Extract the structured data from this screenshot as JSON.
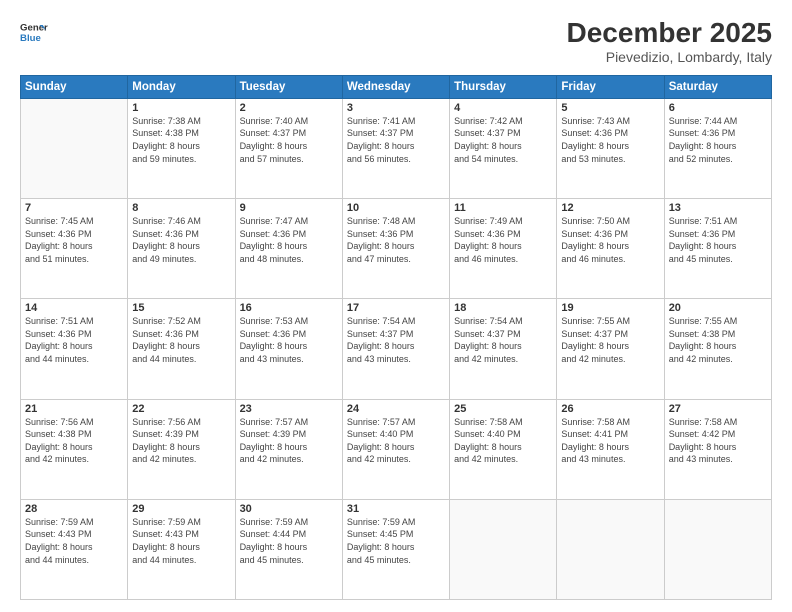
{
  "logo": {
    "line1": "General",
    "line2": "Blue"
  },
  "title": "December 2025",
  "subtitle": "Pievedizio, Lombardy, Italy",
  "weekdays": [
    "Sunday",
    "Monday",
    "Tuesday",
    "Wednesday",
    "Thursday",
    "Friday",
    "Saturday"
  ],
  "weeks": [
    [
      {
        "day": "",
        "info": ""
      },
      {
        "day": "1",
        "info": "Sunrise: 7:38 AM\nSunset: 4:38 PM\nDaylight: 8 hours\nand 59 minutes."
      },
      {
        "day": "2",
        "info": "Sunrise: 7:40 AM\nSunset: 4:37 PM\nDaylight: 8 hours\nand 57 minutes."
      },
      {
        "day": "3",
        "info": "Sunrise: 7:41 AM\nSunset: 4:37 PM\nDaylight: 8 hours\nand 56 minutes."
      },
      {
        "day": "4",
        "info": "Sunrise: 7:42 AM\nSunset: 4:37 PM\nDaylight: 8 hours\nand 54 minutes."
      },
      {
        "day": "5",
        "info": "Sunrise: 7:43 AM\nSunset: 4:36 PM\nDaylight: 8 hours\nand 53 minutes."
      },
      {
        "day": "6",
        "info": "Sunrise: 7:44 AM\nSunset: 4:36 PM\nDaylight: 8 hours\nand 52 minutes."
      }
    ],
    [
      {
        "day": "7",
        "info": "Sunrise: 7:45 AM\nSunset: 4:36 PM\nDaylight: 8 hours\nand 51 minutes."
      },
      {
        "day": "8",
        "info": "Sunrise: 7:46 AM\nSunset: 4:36 PM\nDaylight: 8 hours\nand 49 minutes."
      },
      {
        "day": "9",
        "info": "Sunrise: 7:47 AM\nSunset: 4:36 PM\nDaylight: 8 hours\nand 48 minutes."
      },
      {
        "day": "10",
        "info": "Sunrise: 7:48 AM\nSunset: 4:36 PM\nDaylight: 8 hours\nand 47 minutes."
      },
      {
        "day": "11",
        "info": "Sunrise: 7:49 AM\nSunset: 4:36 PM\nDaylight: 8 hours\nand 46 minutes."
      },
      {
        "day": "12",
        "info": "Sunrise: 7:50 AM\nSunset: 4:36 PM\nDaylight: 8 hours\nand 46 minutes."
      },
      {
        "day": "13",
        "info": "Sunrise: 7:51 AM\nSunset: 4:36 PM\nDaylight: 8 hours\nand 45 minutes."
      }
    ],
    [
      {
        "day": "14",
        "info": "Sunrise: 7:51 AM\nSunset: 4:36 PM\nDaylight: 8 hours\nand 44 minutes."
      },
      {
        "day": "15",
        "info": "Sunrise: 7:52 AM\nSunset: 4:36 PM\nDaylight: 8 hours\nand 44 minutes."
      },
      {
        "day": "16",
        "info": "Sunrise: 7:53 AM\nSunset: 4:36 PM\nDaylight: 8 hours\nand 43 minutes."
      },
      {
        "day": "17",
        "info": "Sunrise: 7:54 AM\nSunset: 4:37 PM\nDaylight: 8 hours\nand 43 minutes."
      },
      {
        "day": "18",
        "info": "Sunrise: 7:54 AM\nSunset: 4:37 PM\nDaylight: 8 hours\nand 42 minutes."
      },
      {
        "day": "19",
        "info": "Sunrise: 7:55 AM\nSunset: 4:37 PM\nDaylight: 8 hours\nand 42 minutes."
      },
      {
        "day": "20",
        "info": "Sunrise: 7:55 AM\nSunset: 4:38 PM\nDaylight: 8 hours\nand 42 minutes."
      }
    ],
    [
      {
        "day": "21",
        "info": "Sunrise: 7:56 AM\nSunset: 4:38 PM\nDaylight: 8 hours\nand 42 minutes."
      },
      {
        "day": "22",
        "info": "Sunrise: 7:56 AM\nSunset: 4:39 PM\nDaylight: 8 hours\nand 42 minutes."
      },
      {
        "day": "23",
        "info": "Sunrise: 7:57 AM\nSunset: 4:39 PM\nDaylight: 8 hours\nand 42 minutes."
      },
      {
        "day": "24",
        "info": "Sunrise: 7:57 AM\nSunset: 4:40 PM\nDaylight: 8 hours\nand 42 minutes."
      },
      {
        "day": "25",
        "info": "Sunrise: 7:58 AM\nSunset: 4:40 PM\nDaylight: 8 hours\nand 42 minutes."
      },
      {
        "day": "26",
        "info": "Sunrise: 7:58 AM\nSunset: 4:41 PM\nDaylight: 8 hours\nand 43 minutes."
      },
      {
        "day": "27",
        "info": "Sunrise: 7:58 AM\nSunset: 4:42 PM\nDaylight: 8 hours\nand 43 minutes."
      }
    ],
    [
      {
        "day": "28",
        "info": "Sunrise: 7:59 AM\nSunset: 4:43 PM\nDaylight: 8 hours\nand 44 minutes."
      },
      {
        "day": "29",
        "info": "Sunrise: 7:59 AM\nSunset: 4:43 PM\nDaylight: 8 hours\nand 44 minutes."
      },
      {
        "day": "30",
        "info": "Sunrise: 7:59 AM\nSunset: 4:44 PM\nDaylight: 8 hours\nand 45 minutes."
      },
      {
        "day": "31",
        "info": "Sunrise: 7:59 AM\nSunset: 4:45 PM\nDaylight: 8 hours\nand 45 minutes."
      },
      {
        "day": "",
        "info": ""
      },
      {
        "day": "",
        "info": ""
      },
      {
        "day": "",
        "info": ""
      }
    ]
  ]
}
